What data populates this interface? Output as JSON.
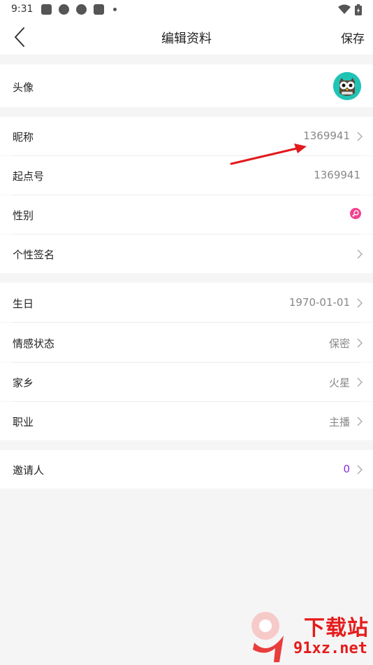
{
  "status_bar": {
    "time": "9:31"
  },
  "header": {
    "title": "编辑资料",
    "save_label": "保存"
  },
  "section_avatar": {
    "label": "头像"
  },
  "section_basic": {
    "nickname": {
      "label": "昵称",
      "value": "1369941"
    },
    "qidian_id": {
      "label": "起点号",
      "value": "1369941"
    },
    "gender": {
      "label": "性别"
    },
    "signature": {
      "label": "个性签名"
    }
  },
  "section_details": {
    "birthday": {
      "label": "生日",
      "value": "1970-01-01"
    },
    "relationship": {
      "label": "情感状态",
      "value": "保密"
    },
    "hometown": {
      "label": "家乡",
      "value": "火星"
    },
    "occupation": {
      "label": "职业",
      "value": "主播"
    }
  },
  "section_invite": {
    "label": "邀请人",
    "value": "0"
  },
  "watermark": {
    "brand": "下载站",
    "url": "91xz.net"
  },
  "colors": {
    "accent_purple": "#8a2be2",
    "gender_pink": "#f2418f",
    "avatar_bg": "#20c4b5",
    "annotation_red": "#e3191b"
  }
}
